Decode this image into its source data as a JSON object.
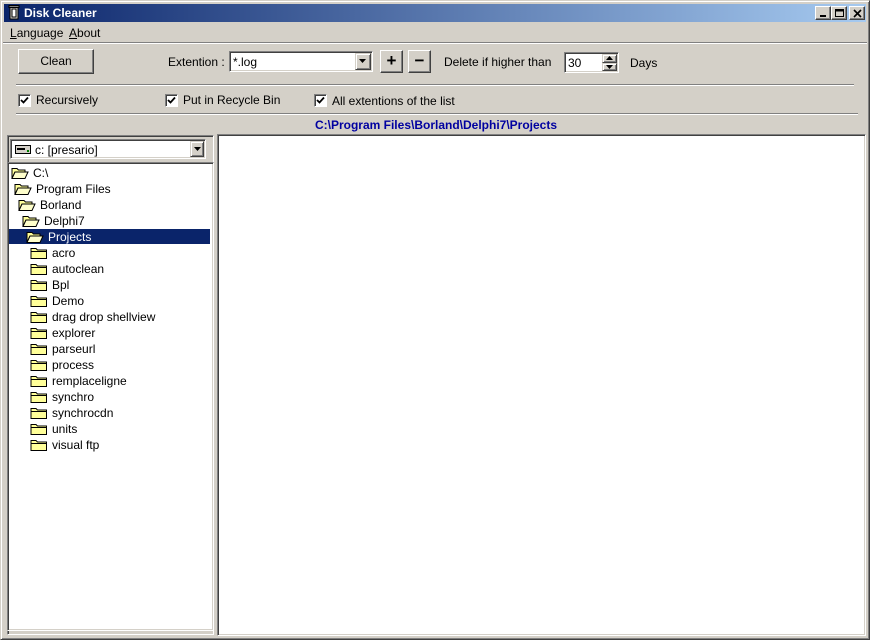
{
  "window": {
    "title": "Disk Cleaner"
  },
  "menu": {
    "language": {
      "accel": "L",
      "rest": "anguage"
    },
    "about": {
      "accel": "A",
      "rest": "bout"
    }
  },
  "toolbar": {
    "clean_label": "Clean",
    "extension_label": "Extention :",
    "extension_value": "*.log",
    "add_label": "+",
    "remove_label": "−",
    "delete_label": "Delete if higher than",
    "days_value": "30",
    "days_label": "Days"
  },
  "options": {
    "recursively": {
      "label": "Recursively",
      "checked": true
    },
    "recycle_bin": {
      "label": "Put in Recycle Bin",
      "checked": true
    },
    "all_extensions": {
      "label": "All extentions of the list",
      "checked": true
    }
  },
  "current_path": "C:\\Program Files\\Borland\\Delphi7\\Projects",
  "drive": {
    "value": "c: [presario]"
  },
  "tree": [
    {
      "label": "C:\\",
      "level": 0,
      "open": true
    },
    {
      "label": "Program Files",
      "level": 1,
      "open": true
    },
    {
      "label": "Borland",
      "level": 2,
      "open": true
    },
    {
      "label": "Delphi7",
      "level": 3,
      "open": true
    },
    {
      "label": "Projects",
      "level": 4,
      "open": true,
      "selected": true
    },
    {
      "label": "acro",
      "level": 5,
      "open": false
    },
    {
      "label": "autoclean",
      "level": 5,
      "open": false
    },
    {
      "label": "Bpl",
      "level": 5,
      "open": false
    },
    {
      "label": "Demo",
      "level": 5,
      "open": false
    },
    {
      "label": "drag drop shellview",
      "level": 5,
      "open": false
    },
    {
      "label": "explorer",
      "level": 5,
      "open": false
    },
    {
      "label": "parseurl",
      "level": 5,
      "open": false
    },
    {
      "label": "process",
      "level": 5,
      "open": false
    },
    {
      "label": "remplaceligne",
      "level": 5,
      "open": false
    },
    {
      "label": "synchro",
      "level": 5,
      "open": false
    },
    {
      "label": "synchrocdn",
      "level": 5,
      "open": false
    },
    {
      "label": "units",
      "level": 5,
      "open": false
    },
    {
      "label": "visual ftp",
      "level": 5,
      "open": false
    }
  ],
  "colors": {
    "titlebar_start": "#0a246a",
    "titlebar_end": "#a6caf0",
    "path_text": "#0000a0",
    "selection": "#0a246a"
  }
}
